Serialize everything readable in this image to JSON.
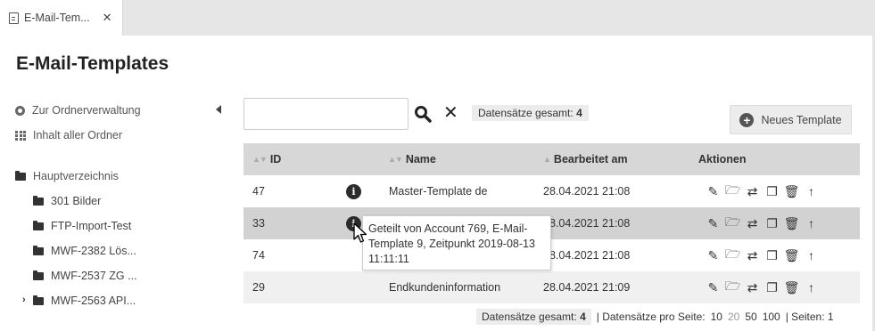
{
  "tab": {
    "label": "E-Mail-Tem...",
    "close": "✕"
  },
  "page_title": "E-Mail-Templates",
  "sidebar": {
    "folder_admin": "Zur Ordnerverwaltung",
    "all_folders": "Inhalt aller Ordner",
    "root": "Hauptverzeichnis",
    "folders": [
      "301 Bilder",
      "FTP-Import-Test",
      "MWF-2382 Lös...",
      "MWF-2537 ZG ...",
      "MWF-2563 API..."
    ]
  },
  "toolbar": {
    "search_value": "",
    "total_label": "Datensätze gesamt:",
    "total_value": "4",
    "new_button": "Neues Template"
  },
  "table": {
    "headers": {
      "id": "ID",
      "name": "Name",
      "edited": "Bearbeitet am",
      "actions": "Aktionen"
    },
    "rows": [
      {
        "id": "47",
        "name": "Master-Template de",
        "edited": "28.04.2021 21:08",
        "info": true
      },
      {
        "id": "33",
        "name": "",
        "edited": "28.04.2021 21:08",
        "info": true
      },
      {
        "id": "74",
        "name": "",
        "edited": "28.04.2021 21:08",
        "info": false
      },
      {
        "id": "29",
        "name": "Endkundeninformation",
        "edited": "28.04.2021 21:09",
        "info": false
      }
    ]
  },
  "tooltip": "Geteilt von Account 769, E-Mail-Template 9, Zeitpunkt 2019-08-13 11:11:11",
  "footer": {
    "total_label": "Datensätze gesamt:",
    "total_value": "4",
    "per_page_label": "| Datensätze pro Seite:",
    "per_page_options": [
      "10",
      "20",
      "50",
      "100"
    ],
    "per_page_active": "20",
    "pages_label": "| Seiten: 1"
  },
  "icons": [
    "file-icon",
    "close-icon",
    "gear-icon",
    "grid-icon",
    "folder-icon",
    "search-icon",
    "clear-icon",
    "plus-circle-icon",
    "info-icon",
    "pencil-icon",
    "folder-open-icon",
    "transfer-icon",
    "copy-icon",
    "trash-icon",
    "upload-icon",
    "cursor-icon"
  ]
}
